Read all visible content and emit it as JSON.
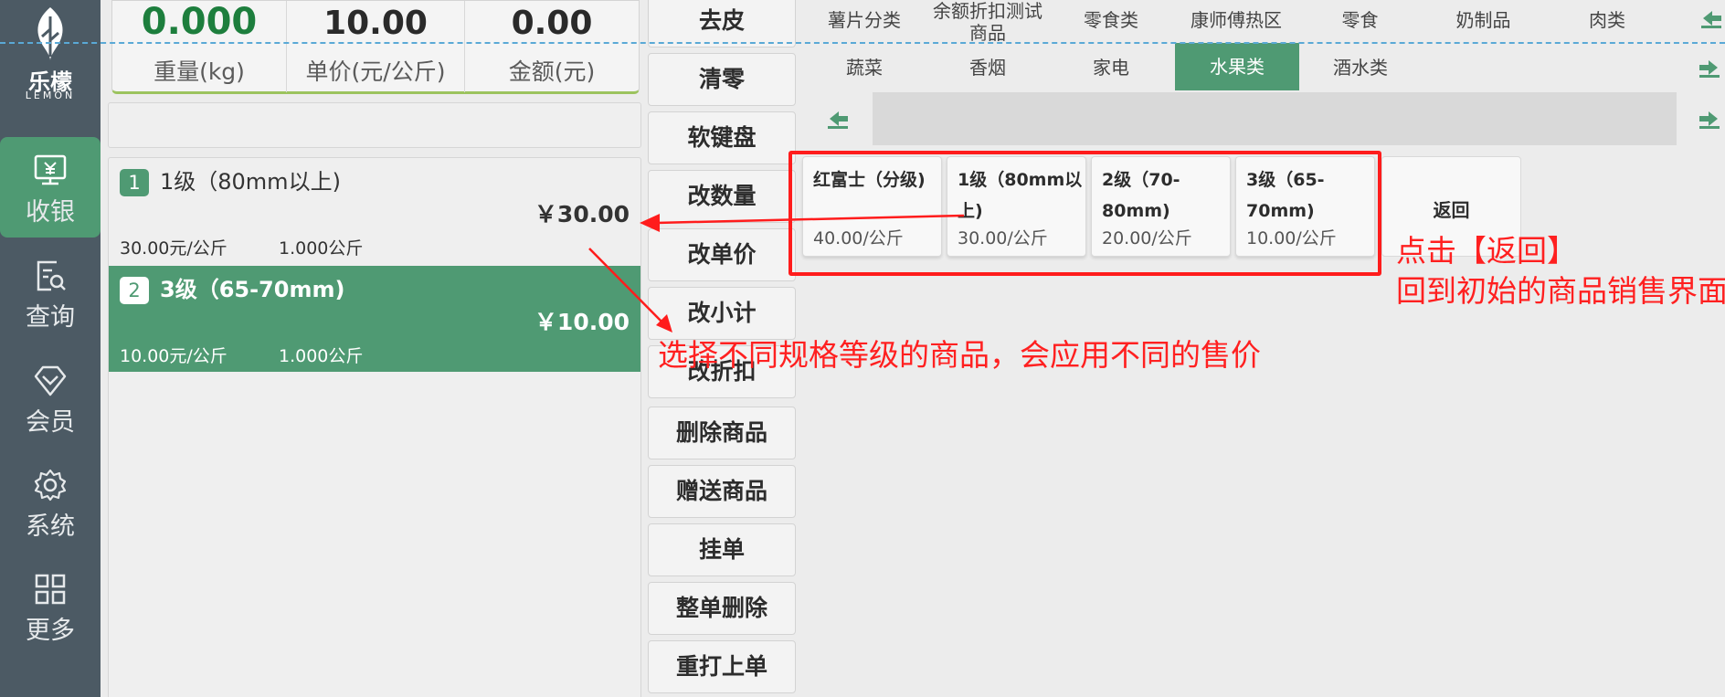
{
  "brand": {
    "name": "乐檬",
    "sub": "LEMON"
  },
  "nav": [
    {
      "label": "收银",
      "icon": "cashier-icon",
      "active": true
    },
    {
      "label": "查询",
      "icon": "query-icon",
      "active": false
    },
    {
      "label": "会员",
      "icon": "member-icon",
      "active": false
    },
    {
      "label": "系统",
      "icon": "gear-icon",
      "active": false
    },
    {
      "label": "更多",
      "icon": "grid-icon",
      "active": false
    }
  ],
  "scale": {
    "weight": {
      "value": "0.000",
      "label": "重量(kg)"
    },
    "unit_price": {
      "value": "10.00",
      "label": "单价(元/公斤)"
    },
    "amount": {
      "value": "0.00",
      "label": "金额(元)"
    }
  },
  "cart": [
    {
      "index": "1",
      "name": "1级（80mm以上)",
      "price": "￥30.00",
      "unit_price": "30.00元/公斤",
      "qty": "1.000公斤",
      "selected": false
    },
    {
      "index": "2",
      "name": "3级（65-70mm)",
      "price": "￥10.00",
      "unit_price": "10.00元/公斤",
      "qty": "1.000公斤",
      "selected": true
    }
  ],
  "actions": [
    "去皮",
    "清零",
    "软键盘",
    "改数量",
    "改单价",
    "改小计",
    "改折扣",
    "删除商品",
    "赠送商品",
    "挂单",
    "整单删除",
    "重打上单"
  ],
  "categories": {
    "row1": [
      "薯片分类",
      "余额折扣测试商品",
      "零食类",
      "康师傅热区",
      "零食",
      "奶制品",
      "肉类"
    ],
    "row2": [
      "蔬菜",
      "香烟",
      "家电",
      "水果类",
      "酒水类"
    ],
    "active": "水果类"
  },
  "products": [
    {
      "name": "红富士（分级)",
      "price": "40.00/公斤"
    },
    {
      "name": "1级（80mm以上)",
      "price": "30.00/公斤"
    },
    {
      "name": "2级（70-80mm)",
      "price": "20.00/公斤"
    },
    {
      "name": "3级（65-70mm)",
      "price": "10.00/公斤"
    }
  ],
  "back_label": "返回",
  "annotations": {
    "back_line1": "点击【返回】",
    "back_line2": "回到初始的商品销售界面",
    "price_note": "选择不同规格等级的商品，会应用不同的售价"
  },
  "colors": {
    "accent": "#4f9a73",
    "sidebar": "#4c5a64",
    "annotation": "#ff1c1c",
    "weight_green": "#1d7e3d"
  }
}
